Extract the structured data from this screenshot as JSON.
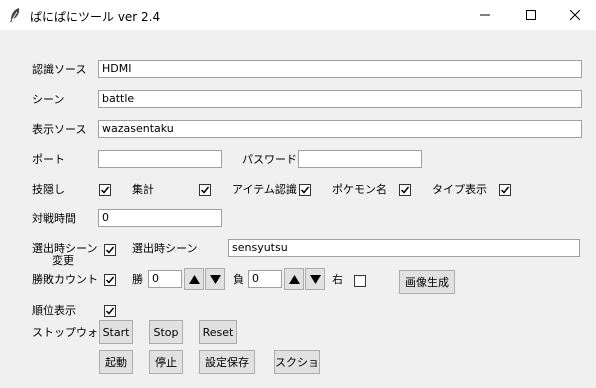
{
  "window": {
    "title": "ぱにぱにツール ver 2.4",
    "minimize": "—",
    "maximize": "☐",
    "close": "✕"
  },
  "form": {
    "source_label": "認識ソース",
    "source_value": "HDMI",
    "scene_label": "シーン",
    "scene_value": "battle",
    "display_source_label": "表示ソース",
    "display_source_value": "wazasentaku",
    "port_label": "ポート",
    "port_value": "",
    "password_label": "パスワード",
    "password_value": "",
    "move_hide_label": "技隠し",
    "move_hide_checked": true,
    "tally_label": "集計",
    "tally_checked": true,
    "item_recog_label": "アイテム認識",
    "item_recog_checked": true,
    "pokemon_name_label": "ポケモン名",
    "pokemon_name_checked": true,
    "type_display_label": "タイプ表示",
    "type_display_checked": true,
    "battle_time_label": "対戦時間",
    "battle_time_value": "0",
    "selection_scene_change_label_1": "選出時シーン",
    "selection_scene_change_label_2": "変更",
    "selection_scene_change_checked": true,
    "selection_scene_label": "選出時シーン",
    "selection_scene_value": "sensyutsu",
    "win_loss_label": "勝敗カウント",
    "win_loss_checked": true,
    "win_label": "勝",
    "win_value": "0",
    "loss_label": "負",
    "loss_value": "0",
    "right_label": "右",
    "right_checked": false,
    "image_gen_button": "画像生成",
    "rank_display_label": "順位表示",
    "rank_display_checked": true,
    "stopwatch_label": "ストップウォッチ",
    "start_button": "Start",
    "stop_button": "Stop",
    "reset_button": "Reset",
    "launch_button": "起動",
    "halt_button": "停止",
    "save_settings_button": "設定保存",
    "screenshot_button": "スクショ"
  }
}
